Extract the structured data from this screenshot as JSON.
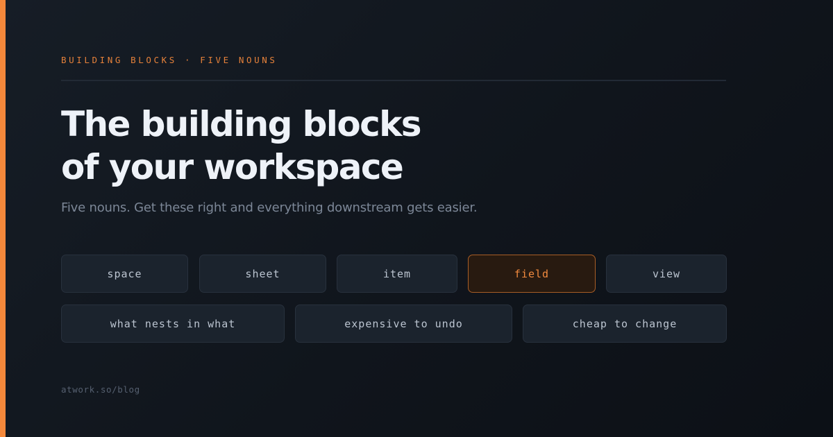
{
  "eyebrow": "BUILDING BLOCKS · FIVE NOUNS",
  "title": {
    "line1": "The building blocks",
    "line2": "of your workspace"
  },
  "subtitle": "Five nouns. Get these right and everything downstream gets easier.",
  "nouns": [
    "space",
    "sheet",
    "item",
    "field",
    "view"
  ],
  "active_noun": "field",
  "principles": [
    "what nests in what",
    "expensive to undo",
    "cheap to change"
  ],
  "footer": "atwork.so/blog",
  "colors": {
    "accent": "#f4883b",
    "background": "#12181f",
    "title": "#eef2f8",
    "muted": "#7c8797"
  }
}
